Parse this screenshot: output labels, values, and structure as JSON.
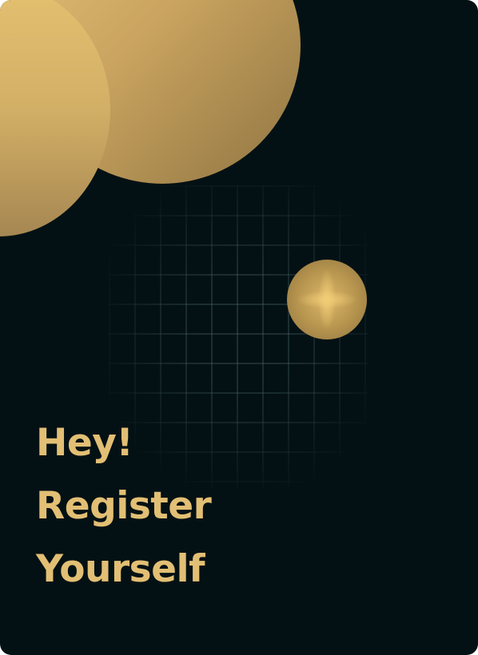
{
  "colors": {
    "background": "#041114",
    "accent": "#e2bf74"
  },
  "headline": {
    "line1": "Hey!",
    "line2": "Register",
    "line3": "Yourself"
  }
}
